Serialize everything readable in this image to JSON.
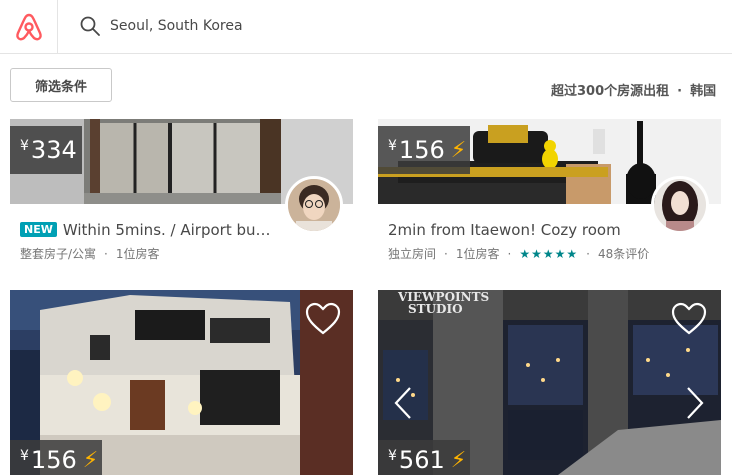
{
  "header": {
    "search_value": "Seoul, South Korea"
  },
  "filters": {
    "button_label": "筛选条件",
    "results_text": "超过300个房源出租",
    "location_crumb": "韩国"
  },
  "listings": [
    {
      "price_symbol": "¥",
      "price": "334",
      "instant_book": false,
      "badge": "NEW",
      "title": "Within 5mins. / Airport bu…",
      "room_type": "整套房子/公寓",
      "guests": "1位房客",
      "rating_stars": "",
      "reviews": ""
    },
    {
      "price_symbol": "¥",
      "price": "156",
      "instant_book": true,
      "badge": "",
      "title": "2min from Itaewon! Cozy room",
      "room_type": "独立房间",
      "guests": "1位房客",
      "rating_stars": "★★★★★",
      "rating": 5,
      "reviews": "48条评价"
    },
    {
      "price_symbol": "¥",
      "price": "156",
      "instant_book": true
    },
    {
      "price_symbol": "¥",
      "price": "561",
      "instant_book": true,
      "watermark_line1": "VIEWPOINTS",
      "watermark_line2": "STUDIO"
    }
  ],
  "colors": {
    "brand": "#ff5a5f",
    "new_badge": "#00a0b4",
    "stars": "#00868a",
    "instant_bolt": "#ffb400"
  }
}
